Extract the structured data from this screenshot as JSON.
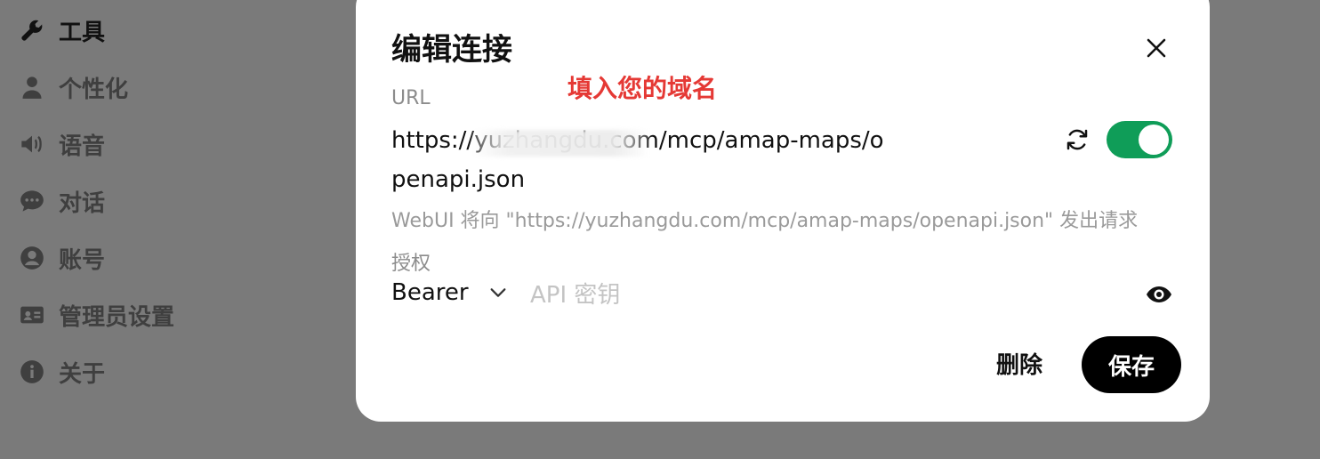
{
  "sidebar": {
    "items": [
      {
        "label": "工具",
        "icon": "wrench-icon",
        "active": true
      },
      {
        "label": "个性化",
        "icon": "user-icon"
      },
      {
        "label": "语音",
        "icon": "speaker-icon"
      },
      {
        "label": "对话",
        "icon": "chat-icon"
      },
      {
        "label": "账号",
        "icon": "account-icon"
      },
      {
        "label": "管理员设置",
        "icon": "admin-card-icon"
      },
      {
        "label": "关于",
        "icon": "info-icon"
      }
    ]
  },
  "modal": {
    "title": "编辑连接",
    "annotation": "填入您的域名",
    "url_label": "URL",
    "url_value": "https://yuzhangdu.com/mcp/amap-maps/openapi.json",
    "url_enabled": true,
    "hint": "WebUI 将向 \"https://yuzhangdu.com/mcp/amap-maps/openapi.json\" 发出请求",
    "auth_label": "授权",
    "auth_type": "Bearer",
    "api_key_placeholder": "API 密钥",
    "api_key_value": "",
    "delete_label": "删除",
    "save_label": "保存"
  },
  "colors": {
    "accent_toggle": "#0f9d58",
    "annotation": "#e53935",
    "overlay": "#7a7a7a"
  }
}
